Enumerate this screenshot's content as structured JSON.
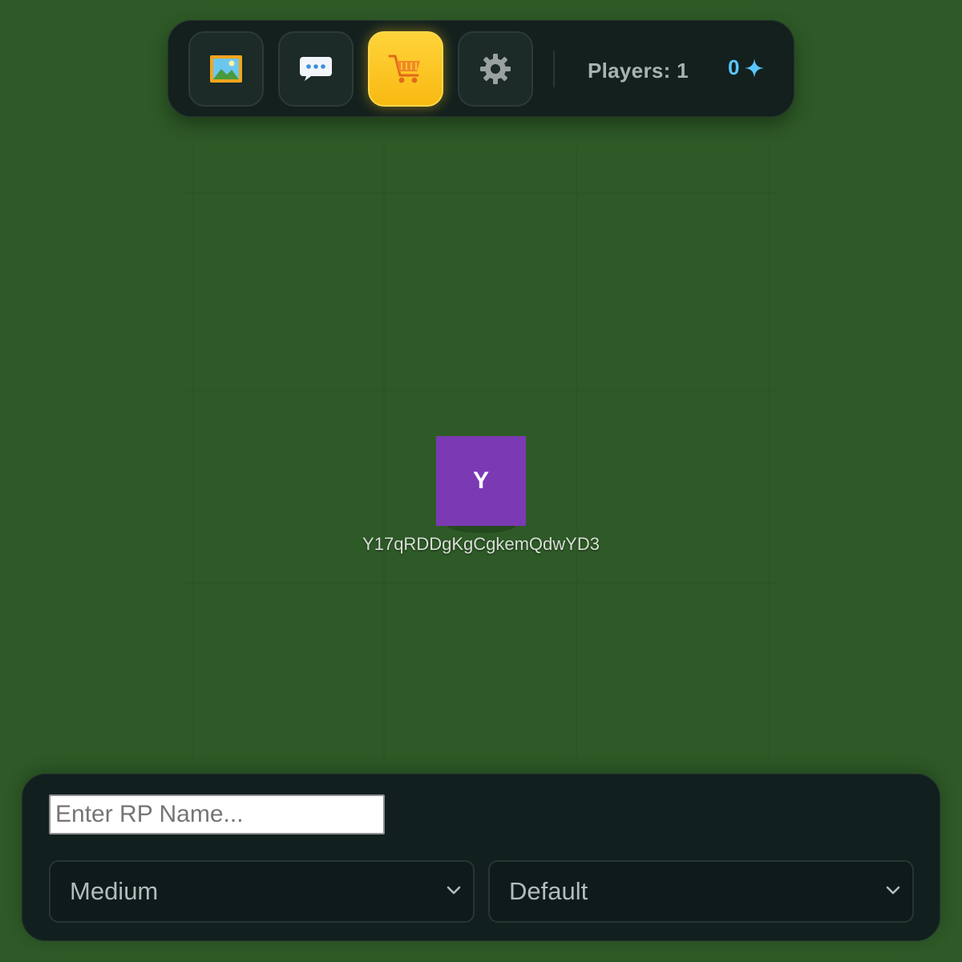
{
  "toolbar": {
    "buttons": [
      {
        "name": "gallery-button",
        "icon": "framed-picture-icon",
        "active": false
      },
      {
        "name": "chat-button",
        "icon": "speech-bubble-icon",
        "active": false
      },
      {
        "name": "shop-button",
        "icon": "shopping-cart-icon",
        "active": true
      },
      {
        "name": "settings-button",
        "icon": "gear-icon",
        "active": false
      }
    ],
    "players_label": "Players: 1",
    "currency_value": "0",
    "currency_icon": "sparkle-icon"
  },
  "player": {
    "initial": "Y",
    "name": "Y17qRDDgKgCgkemQdwYD3",
    "color": "#7b3ab4"
  },
  "bottom_panel": {
    "rp_name_placeholder": "Enter RP Name...",
    "rp_name_value": "",
    "size_select": {
      "selected": "Medium"
    },
    "style_select": {
      "selected": "Default"
    }
  },
  "colors": {
    "ground": "#2e5a27",
    "panel": "#111f1e",
    "accent_active": "#ffc61f",
    "currency": "#59c6ff"
  }
}
